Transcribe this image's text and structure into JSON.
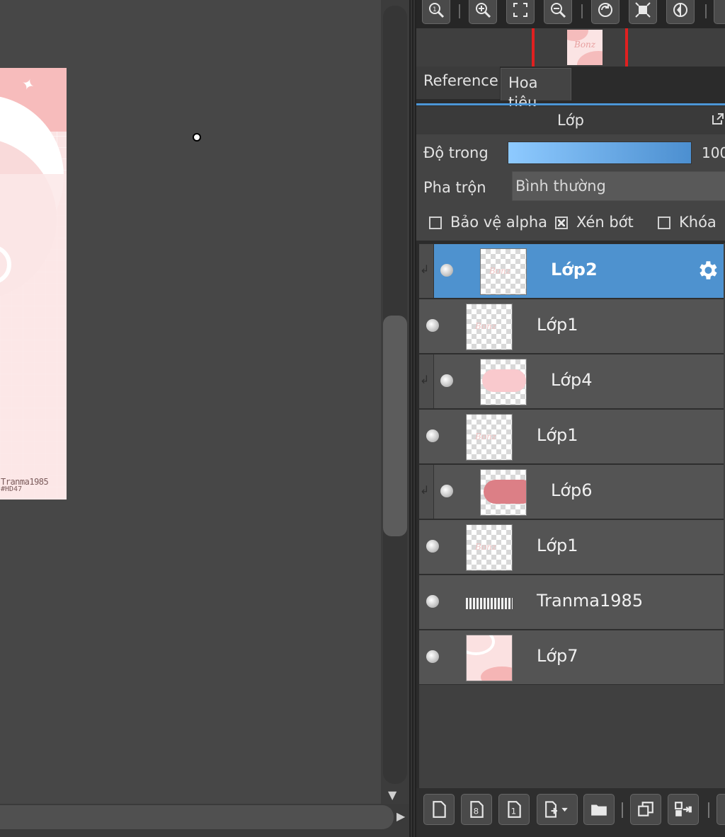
{
  "canvas": {
    "signature_line1": "Tranma1985",
    "signature_line2": "#HD47"
  },
  "navigator": {
    "toolbar_icons": [
      "zoom-100-icon",
      "zoom-in-icon",
      "fit-screen-icon",
      "zoom-out-icon",
      "rotate-icon",
      "fit-window-icon",
      "flip-icon",
      "more-icon"
    ],
    "thumbnail_text": "Bonz"
  },
  "tabs": {
    "reference": "Reference",
    "navigator": "Hoa tiêu"
  },
  "layer_panel": {
    "title": "Lớp",
    "opacity_label": "Độ trong",
    "opacity_value": "100",
    "opacity_percent": 100,
    "blend_label": "Pha trộn",
    "blend_value": "Bình thường",
    "protect_alpha_label": "Bảo vệ alpha",
    "protect_alpha_checked": false,
    "clipping_label": "Xén bớt",
    "clipping_checked": true,
    "lock_label": "Khóa",
    "lock_checked": false,
    "accent_color": "#4e92cf"
  },
  "layers": [
    {
      "name": "Lớp2",
      "selected": true,
      "clipped": true,
      "visible": true
    },
    {
      "name": "Lớp1",
      "selected": false,
      "clipped": false,
      "visible": true
    },
    {
      "name": "Lớp4",
      "selected": false,
      "clipped": true,
      "visible": true
    },
    {
      "name": "Lớp1",
      "selected": false,
      "clipped": false,
      "visible": true
    },
    {
      "name": "Lớp6",
      "selected": false,
      "clipped": true,
      "visible": true
    },
    {
      "name": "Lớp1",
      "selected": false,
      "clipped": false,
      "visible": true
    },
    {
      "name": "Tranma1985",
      "selected": false,
      "clipped": false,
      "visible": true
    },
    {
      "name": "Lớp7",
      "selected": false,
      "clipped": false,
      "visible": true
    }
  ],
  "bottom_toolbar_icons": [
    "new-layer-icon",
    "new-8bit-layer-icon",
    "new-1bit-layer-icon",
    "add-layer-menu-icon",
    "new-folder-icon",
    "duplicate-layer-icon",
    "merge-down-icon",
    "more-icon"
  ]
}
